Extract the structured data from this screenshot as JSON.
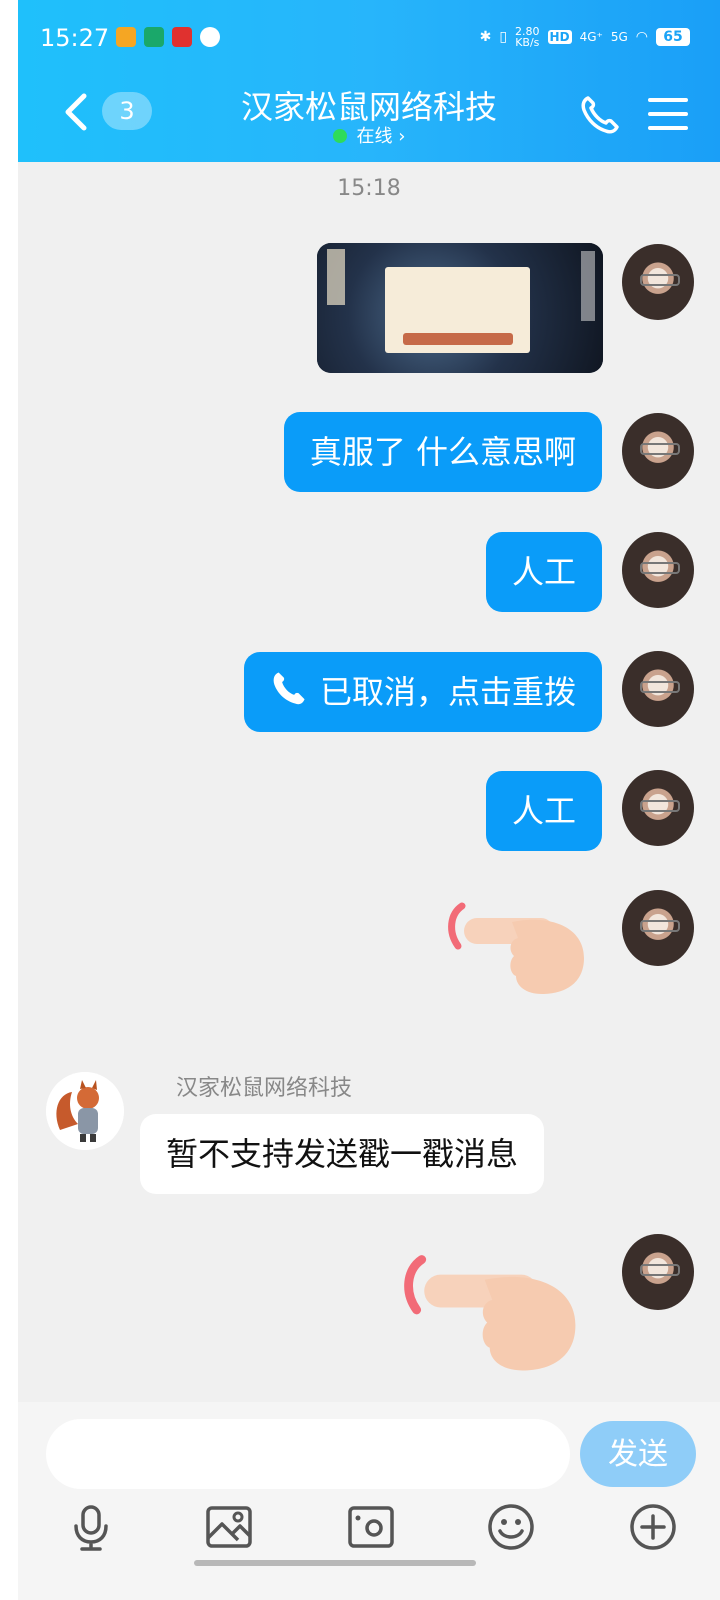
{
  "status_bar": {
    "time": "15:27",
    "net_speed_value": "2.80",
    "net_speed_unit": "KB/s",
    "hd": "HD",
    "sim1": "4G⁺",
    "sim2": "5G",
    "battery": "65"
  },
  "header": {
    "unread_badge": "3",
    "title": "汉家松鼠网络科技",
    "status": "在线 ›"
  },
  "chat": {
    "timestamp": "15:18",
    "messages": [
      {
        "from": "me",
        "type": "image"
      },
      {
        "from": "me",
        "type": "text",
        "text": "真服了 什么意思啊"
      },
      {
        "from": "me",
        "type": "text",
        "text": "人工"
      },
      {
        "from": "me",
        "type": "call",
        "text": "已取消，点击重拨"
      },
      {
        "from": "me",
        "type": "text",
        "text": "人工"
      },
      {
        "from": "me",
        "type": "poke"
      },
      {
        "from": "bot",
        "type": "text",
        "sender": "汉家松鼠网络科技",
        "text": "暂不支持发送戳一戳消息"
      },
      {
        "from": "me",
        "type": "poke"
      }
    ]
  },
  "input": {
    "value": "",
    "send_label": "发送"
  },
  "icons": [
    "microphone-icon",
    "photo-icon",
    "camera-icon",
    "emoji-icon",
    "plus-icon"
  ],
  "colors": {
    "header": "#1fc0fb",
    "my_bubble": "#0a9cf9",
    "send_button": "#8fcdf8",
    "background": "#f0f0f0"
  }
}
